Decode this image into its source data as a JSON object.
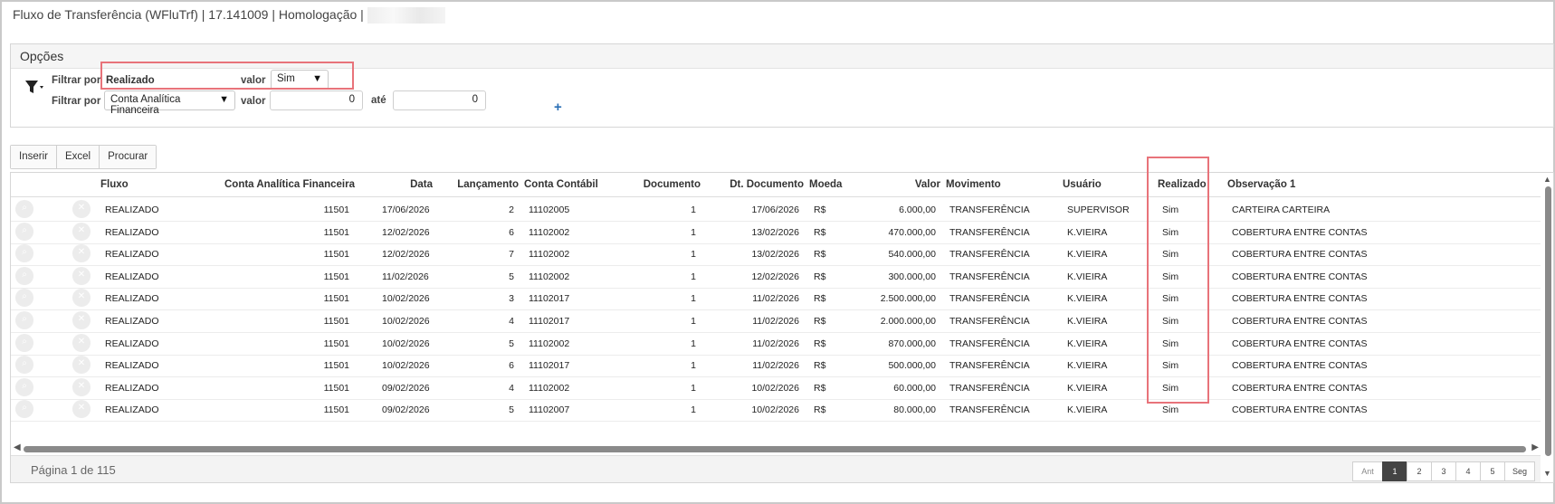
{
  "title": "Fluxo de Transferência (WFluTrf) | 17.141009 | Homologação |",
  "options": {
    "header": "Opções",
    "filter1": {
      "label": "Filtrar por",
      "field": "Realizado",
      "value_label": "valor",
      "value": "Sim"
    },
    "filter2": {
      "label": "Filtrar por",
      "field": "Conta Analítica Financeira",
      "value_label": "valor",
      "from": "0",
      "to_label": "até",
      "to": "0"
    },
    "add_symbol": "+"
  },
  "buttons": {
    "insert": "Inserir",
    "excel": "Excel",
    "search": "Procurar"
  },
  "grid": {
    "headers": [
      "Fluxo",
      "Conta Analítica Financeira",
      "Data",
      "Lançamento",
      "Conta Contábil",
      "Documento",
      "Dt. Documento",
      "Moeda",
      "Valor",
      "Movimento",
      "Usuário",
      "Realizado",
      "Observação 1"
    ],
    "rows": [
      [
        "REALIZADO",
        "11501",
        "17/06/2026",
        "2",
        "11102005",
        "1",
        "17/06/2026",
        "R$",
        "6.000,00",
        "TRANSFERÊNCIA",
        "SUPERVISOR",
        "Sim",
        "CARTEIRA CARTEIRA"
      ],
      [
        "REALIZADO",
        "11501",
        "12/02/2026",
        "6",
        "11102002",
        "1",
        "13/02/2026",
        "R$",
        "470.000,00",
        "TRANSFERÊNCIA",
        "K.VIEIRA",
        "Sim",
        "COBERTURA ENTRE CONTAS"
      ],
      [
        "REALIZADO",
        "11501",
        "12/02/2026",
        "7",
        "11102002",
        "1",
        "13/02/2026",
        "R$",
        "540.000,00",
        "TRANSFERÊNCIA",
        "K.VIEIRA",
        "Sim",
        "COBERTURA ENTRE CONTAS"
      ],
      [
        "REALIZADO",
        "11501",
        "11/02/2026",
        "5",
        "11102002",
        "1",
        "12/02/2026",
        "R$",
        "300.000,00",
        "TRANSFERÊNCIA",
        "K.VIEIRA",
        "Sim",
        "COBERTURA ENTRE CONTAS"
      ],
      [
        "REALIZADO",
        "11501",
        "10/02/2026",
        "3",
        "11102017",
        "1",
        "11/02/2026",
        "R$",
        "2.500.000,00",
        "TRANSFERÊNCIA",
        "K.VIEIRA",
        "Sim",
        "COBERTURA ENTRE CONTAS"
      ],
      [
        "REALIZADO",
        "11501",
        "10/02/2026",
        "4",
        "11102017",
        "1",
        "11/02/2026",
        "R$",
        "2.000.000,00",
        "TRANSFERÊNCIA",
        "K.VIEIRA",
        "Sim",
        "COBERTURA ENTRE CONTAS"
      ],
      [
        "REALIZADO",
        "11501",
        "10/02/2026",
        "5",
        "11102002",
        "1",
        "11/02/2026",
        "R$",
        "870.000,00",
        "TRANSFERÊNCIA",
        "K.VIEIRA",
        "Sim",
        "COBERTURA ENTRE CONTAS"
      ],
      [
        "REALIZADO",
        "11501",
        "10/02/2026",
        "6",
        "11102017",
        "1",
        "11/02/2026",
        "R$",
        "500.000,00",
        "TRANSFERÊNCIA",
        "K.VIEIRA",
        "Sim",
        "COBERTURA ENTRE CONTAS"
      ],
      [
        "REALIZADO",
        "11501",
        "09/02/2026",
        "4",
        "11102002",
        "1",
        "10/02/2026",
        "R$",
        "60.000,00",
        "TRANSFERÊNCIA",
        "K.VIEIRA",
        "Sim",
        "COBERTURA ENTRE CONTAS"
      ],
      [
        "REALIZADO",
        "11501",
        "09/02/2026",
        "5",
        "11102007",
        "1",
        "10/02/2026",
        "R$",
        "80.000,00",
        "TRANSFERÊNCIA",
        "K.VIEIRA",
        "Sim",
        "COBERTURA ENTRE CONTAS"
      ]
    ],
    "row_icons": [
      "search-icon",
      "close-icon"
    ]
  },
  "pagination": {
    "info": "Página 1 de 115",
    "prev": "Ant",
    "pages": [
      "1",
      "2",
      "3",
      "4",
      "5"
    ],
    "next": "Seg",
    "current": "1"
  },
  "colors": {
    "highlight": "#e8737a",
    "link": "#2a6fb5"
  }
}
